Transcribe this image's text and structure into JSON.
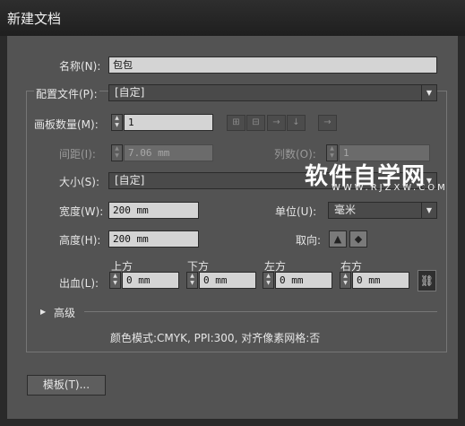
{
  "window": {
    "title": "新建文档"
  },
  "form": {
    "name_label": "名称(N):",
    "name_value": "包包",
    "profile_label": "配置文件(P):",
    "profile_value": "[自定]",
    "artboards_label": "画板数量(M):",
    "artboards_value": "1",
    "spacing_label": "间距(I):",
    "spacing_value": "7.06 mm",
    "columns_label": "列数(O):",
    "columns_value": "1",
    "size_label": "大小(S):",
    "size_value": "[自定]",
    "width_label": "宽度(W):",
    "width_value": "200 mm",
    "height_label": "高度(H):",
    "height_value": "200 mm",
    "units_label": "单位(U):",
    "units_value": "毫米",
    "orientation_label": "取向:",
    "bleed_label": "出血(L):",
    "bleed": {
      "top_label": "上方",
      "top_value": "0 mm",
      "bottom_label": "下方",
      "bottom_value": "0 mm",
      "left_label": "左方",
      "left_value": "0 mm",
      "right_label": "右方",
      "right_value": "0 mm"
    },
    "advanced_label": "高级",
    "info_text": "颜色模式:CMYK, PPI:300, 对齐像素网格:否"
  },
  "buttons": {
    "templates_label": "模板(T)..."
  },
  "watermark": {
    "main": "软件自学网",
    "sub": "WWW.RJZXW.COM"
  }
}
